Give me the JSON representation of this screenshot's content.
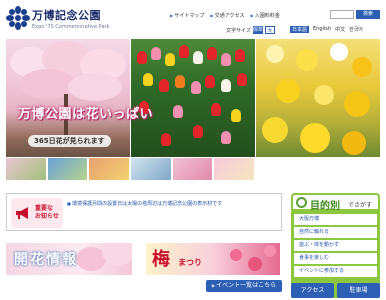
{
  "header": {
    "title": "万博記念公園",
    "subtitle": "Expo '70 Commemorative Park",
    "links": [
      "サイトマップ",
      "交通アクセス",
      "入園料料金"
    ],
    "search_button": "検索",
    "font_size_label": "文字サイズ",
    "font_size_options": [
      "標準",
      "大"
    ],
    "languages": [
      "日本語",
      "English",
      "中文",
      "한국어"
    ]
  },
  "hero": {
    "caption": "万博公園は花いっぱい",
    "sub_caption": "365日花が見られます"
  },
  "notice": {
    "label_line1": "重要な",
    "label_line2": "お知らせ",
    "text": "環境保護月間の設置日は太陽の塔周辺は万博記念公園の表示材です"
  },
  "banners": {
    "flower": "開花情報",
    "ume_main": "梅",
    "ume_sub": "まつり"
  },
  "event_button": "イベント一覧はこちら",
  "sidebar": {
    "title_main": "目的別",
    "title_sub": "でさがす",
    "items": [
      "大阪万博",
      "自然に触れる",
      "遊ぶ・体を動かす",
      "食事を楽しむ",
      "イベントに参加する"
    ],
    "access": "アクセス",
    "parking": "駐車場"
  },
  "colors": {
    "brand_blue": "#2d5fb5",
    "sidebar_green": "#8dc63f",
    "notice_red": "#c8102e"
  }
}
